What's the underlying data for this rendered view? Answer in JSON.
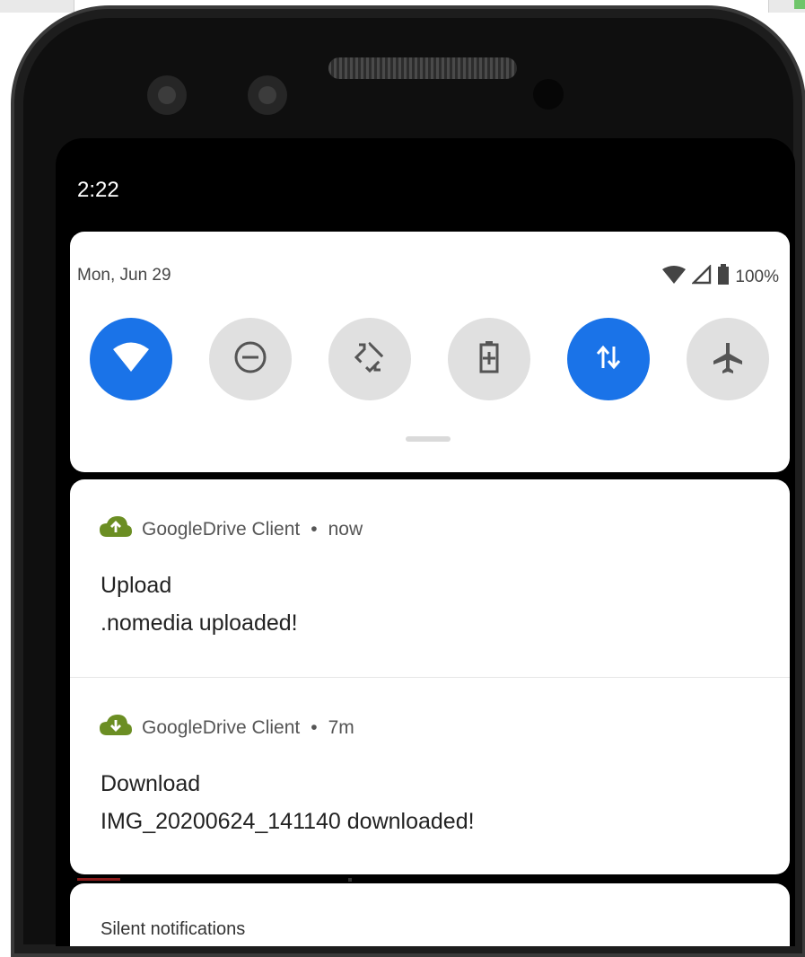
{
  "status_bar": {
    "time": "2:22"
  },
  "quick_settings": {
    "date": "Mon, Jun 29",
    "battery_percent": "100%",
    "tiles": [
      {
        "id": "wifi",
        "icon": "wifi-icon",
        "active": true
      },
      {
        "id": "dnd",
        "icon": "do-not-disturb-icon",
        "active": false
      },
      {
        "id": "auto-rotate",
        "icon": "auto-rotate-icon",
        "active": false
      },
      {
        "id": "battery-saver",
        "icon": "battery-saver-icon",
        "active": false
      },
      {
        "id": "mobile-data",
        "icon": "mobile-data-icon",
        "active": true
      },
      {
        "id": "airplane",
        "icon": "airplane-icon",
        "active": false
      }
    ]
  },
  "notifications": [
    {
      "app": "GoogleDrive Client",
      "time": "now",
      "title": "Upload",
      "body": ".nomedia uploaded!",
      "icon": "cloud-upload-icon"
    },
    {
      "app": "GoogleDrive Client",
      "time": "7m",
      "title": "Download",
      "body": "IMG_20200624_141140 downloaded!",
      "icon": "cloud-download-icon"
    }
  ],
  "silent_section": {
    "label": "Silent notifications"
  },
  "colors": {
    "accent": "#1a73e8",
    "inactive_tile": "#e0e0e0",
    "app_icon": "#6b8e23",
    "screen_bg": "#000000"
  }
}
